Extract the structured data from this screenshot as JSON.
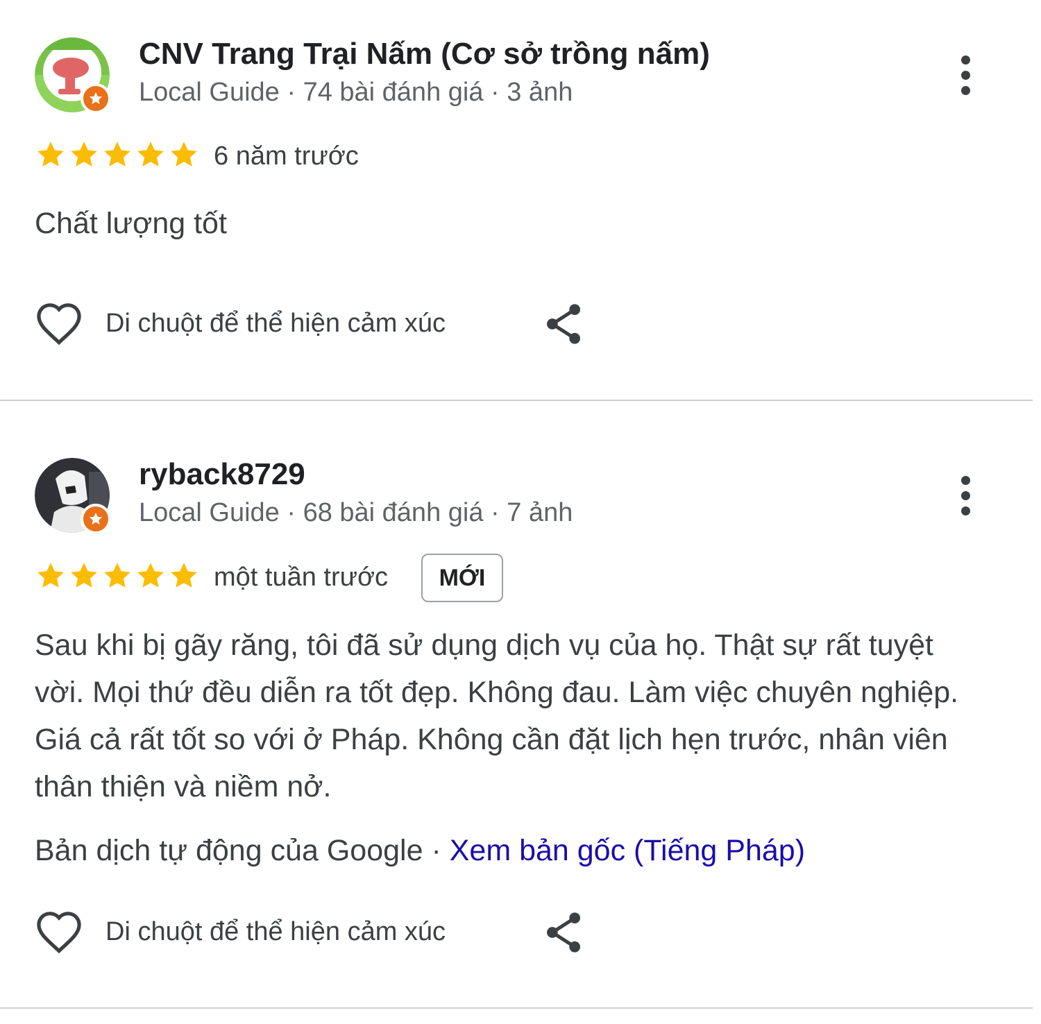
{
  "colors": {
    "star": "#fbbc04",
    "link": "#1a0dab",
    "badge": "#e8711a"
  },
  "reviews": [
    {
      "author": "CNV Trang Trại Nấm (Cơ sở trồng nấm)",
      "meta": "Local Guide · 74 bài đánh giá · 3 ảnh",
      "rating": 5,
      "time": "6 năm trước",
      "text": "Chất lượng tốt",
      "reaction_label": "Di chuột để thể hiện cảm xúc",
      "avatar_icon": "mushroom-avatar-icon"
    },
    {
      "author": "ryback8729",
      "meta": "Local Guide · 68 bài đánh giá · 7 ảnh",
      "rating": 5,
      "time": "một tuần trước",
      "badge": "MỚI",
      "text": "Sau khi bị gãy răng, tôi đã sử dụng dịch vụ của họ. Thật sự rất tuyệt vời. Mọi thứ đều diễn ra tốt đẹp. Không đau. Làm việc chuyên nghiệp. Giá cả rất tốt so với ở Pháp. Không cần đặt lịch hẹn trước, nhân viên thân thiện và niềm nở.",
      "translation_prefix": "Bản dịch tự động của Google · ",
      "translation_link": "Xem bản gốc (Tiếng Pháp)",
      "reaction_label": "Di chuột để thể hiện cảm xúc",
      "avatar_icon": "stormtrooper-avatar-icon"
    }
  ]
}
